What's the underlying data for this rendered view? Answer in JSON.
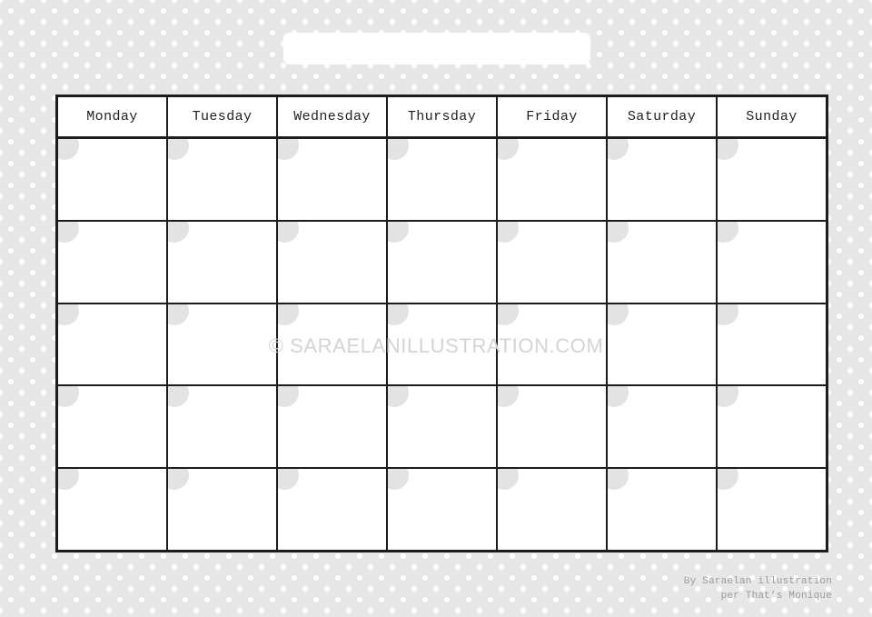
{
  "page": {
    "background_color": "#e7e7e7",
    "dot_color": "#ffffff"
  },
  "title": {
    "value": "",
    "placeholder": ""
  },
  "calendar": {
    "border_color": "#1c1c1c",
    "cell_background": "#ffffff",
    "day_dot_color": "#e3e3e3",
    "headers": [
      "Monday",
      "Tuesday",
      "Wednesday",
      "Thursday",
      "Friday",
      "Saturday",
      "Sunday"
    ],
    "weeks": [
      [
        {
          "number": "",
          "note": ""
        },
        {
          "number": "",
          "note": ""
        },
        {
          "number": "",
          "note": ""
        },
        {
          "number": "",
          "note": ""
        },
        {
          "number": "",
          "note": ""
        },
        {
          "number": "",
          "note": ""
        },
        {
          "number": "",
          "note": ""
        }
      ],
      [
        {
          "number": "",
          "note": ""
        },
        {
          "number": "",
          "note": ""
        },
        {
          "number": "",
          "note": ""
        },
        {
          "number": "",
          "note": ""
        },
        {
          "number": "",
          "note": ""
        },
        {
          "number": "",
          "note": ""
        },
        {
          "number": "",
          "note": ""
        }
      ],
      [
        {
          "number": "",
          "note": ""
        },
        {
          "number": "",
          "note": ""
        },
        {
          "number": "",
          "note": ""
        },
        {
          "number": "",
          "note": ""
        },
        {
          "number": "",
          "note": ""
        },
        {
          "number": "",
          "note": ""
        },
        {
          "number": "",
          "note": ""
        }
      ],
      [
        {
          "number": "",
          "note": ""
        },
        {
          "number": "",
          "note": ""
        },
        {
          "number": "",
          "note": ""
        },
        {
          "number": "",
          "note": ""
        },
        {
          "number": "",
          "note": ""
        },
        {
          "number": "",
          "note": ""
        },
        {
          "number": "",
          "note": ""
        }
      ],
      [
        {
          "number": "",
          "note": ""
        },
        {
          "number": "",
          "note": ""
        },
        {
          "number": "",
          "note": ""
        },
        {
          "number": "",
          "note": ""
        },
        {
          "number": "",
          "note": ""
        },
        {
          "number": "",
          "note": ""
        },
        {
          "number": "",
          "note": ""
        }
      ]
    ]
  },
  "watermark": {
    "text": "© SARAELANILLUSTRATION.COM",
    "color": "#d4d4d4"
  },
  "credit": {
    "line1": "By Saraelan illustration",
    "line2": "per That’s Monique",
    "color": "#9a9a9a"
  }
}
